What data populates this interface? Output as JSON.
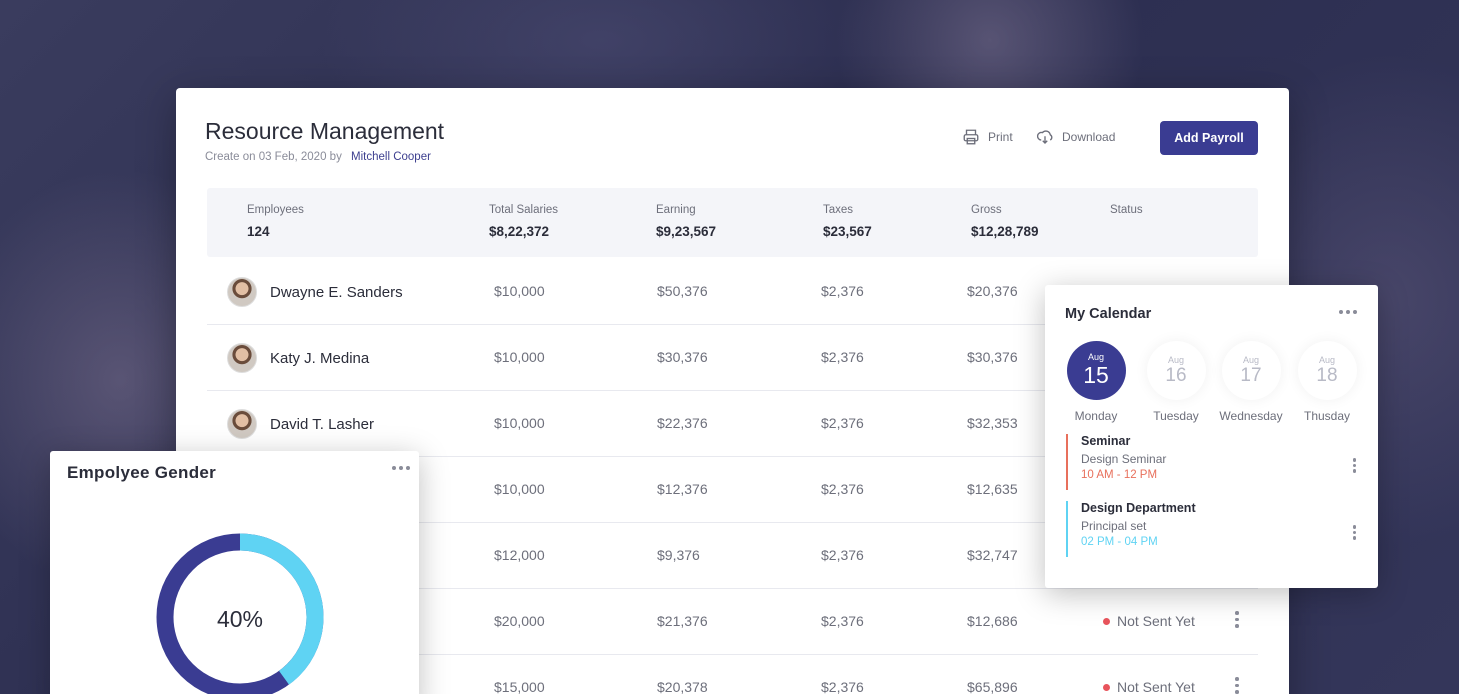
{
  "header": {
    "title": "Resource Management",
    "created_prefix": "Create on 03 Feb, 2020 by",
    "author": "Mitchell Cooper",
    "print_label": "Print",
    "download_label": "Download",
    "add_payroll_label": "Add Payroll"
  },
  "summary": {
    "employees_label": "Employees",
    "employees_value": "124",
    "salaries_label": "Total Salaries",
    "salaries_value": "$8,22,372",
    "earning_label": "Earning",
    "earning_value": "$9,23,567",
    "taxes_label": "Taxes",
    "taxes_value": "$23,567",
    "gross_label": "Gross",
    "gross_value": "$12,28,789",
    "status_label": "Status"
  },
  "rows": [
    {
      "name": "Dwayne E. Sanders",
      "salary": "$10,000",
      "earning": "$50,376",
      "tax": "$2,376",
      "gross": "$20,376",
      "status": ""
    },
    {
      "name": "Katy J. Medina",
      "salary": "$10,000",
      "earning": "$30,376",
      "tax": "$2,376",
      "gross": "$30,376",
      "status": ""
    },
    {
      "name": "David T. Lasher",
      "salary": "$10,000",
      "earning": "$22,376",
      "tax": "$2,376",
      "gross": "$32,353",
      "status": ""
    },
    {
      "name": "",
      "salary": "$10,000",
      "earning": "$12,376",
      "tax": "$2,376",
      "gross": "$12,635",
      "status": ""
    },
    {
      "name": "",
      "salary": "$12,000",
      "earning": "$9,376",
      "tax": "$2,376",
      "gross": "$32,747",
      "status": ""
    },
    {
      "name": "",
      "salary": "$20,000",
      "earning": "$21,376",
      "tax": "$2,376",
      "gross": "$12,686",
      "status": "Not Sent Yet"
    },
    {
      "name": "",
      "salary": "$15,000",
      "earning": "$20,378",
      "tax": "$2,376",
      "gross": "$65,896",
      "status": "Not Sent Yet"
    }
  ],
  "gender": {
    "title": "Empolyee Gender",
    "percent_label": "40%",
    "percent_value": 0.4,
    "colors": {
      "primary": "#3a3c92",
      "secondary": "#5fd3f3"
    }
  },
  "calendar": {
    "title": "My Calendar",
    "days": [
      {
        "month": "Aug",
        "day": "15",
        "weekday": "Monday",
        "active": true
      },
      {
        "month": "Aug",
        "day": "16",
        "weekday": "Tuesday",
        "active": false
      },
      {
        "month": "Aug",
        "day": "17",
        "weekday": "Wednesday",
        "active": false
      },
      {
        "month": "Aug",
        "day": "18",
        "weekday": "Thusday",
        "active": false
      }
    ],
    "events": [
      {
        "title": "Seminar",
        "subtitle": "Design Seminar",
        "time": "10 AM - 12 PM",
        "color": "#e8705c"
      },
      {
        "title": "Design Department",
        "subtitle": "Principal set",
        "time": "02 PM - 04 PM",
        "color": "#5fd3f3"
      }
    ]
  },
  "colors": {
    "accent": "#3a3c92",
    "status_dot": "#e8545c"
  }
}
